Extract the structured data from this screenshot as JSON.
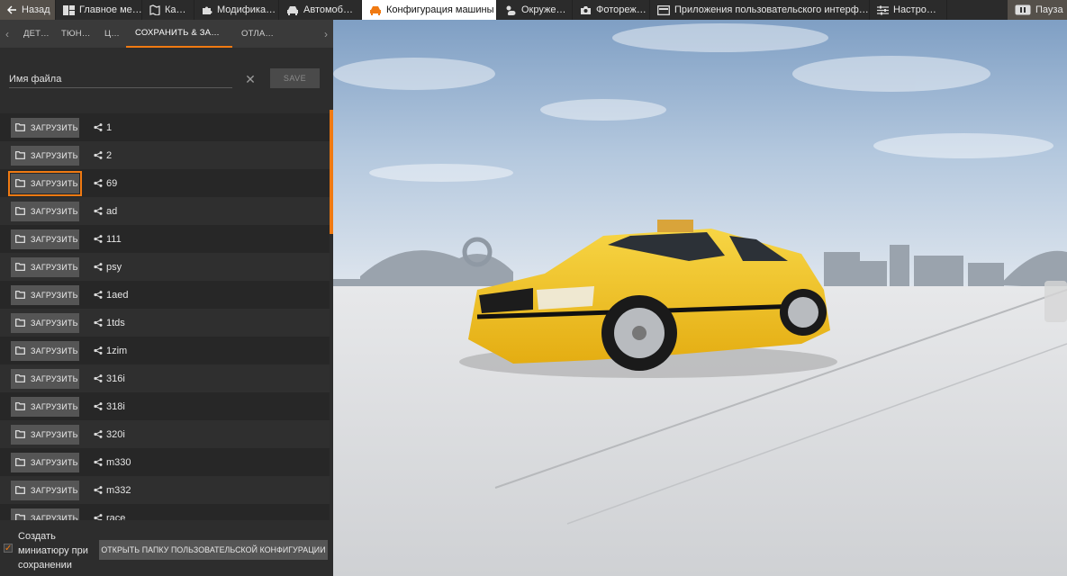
{
  "topbar": {
    "back": "Назад",
    "items": [
      {
        "label": "Главное ме…",
        "icon": "main-menu-icon"
      },
      {
        "label": "Ка…",
        "icon": "map-icon"
      },
      {
        "label": "Модифика…",
        "icon": "puzzle-icon"
      },
      {
        "label": "Автомоб…",
        "icon": "car-icon"
      },
      {
        "label": "Конфигурация машины",
        "icon": "car-config-icon"
      },
      {
        "label": "Окруже…",
        "icon": "weather-icon"
      },
      {
        "label": "Фотореж…",
        "icon": "camera-icon"
      },
      {
        "label": "Приложения пользовательского интерф…",
        "icon": "apps-icon"
      },
      {
        "label": "Настро…",
        "icon": "settings-sliders-icon"
      }
    ],
    "pause": "Пауза"
  },
  "tabs": {
    "items": [
      "ДЕТ…",
      "ТЮН…",
      "Ц…",
      "СОХРАНИТЬ & ЗА…",
      "ОТЛА…"
    ],
    "active_index": 3
  },
  "save": {
    "placeholder": "Имя файла",
    "clear_symbol": "✕",
    "button": "SAVE"
  },
  "configs": {
    "load_label": "ЗАГРУЗИТЬ",
    "focused_index": 2,
    "items": [
      "1",
      "2",
      "69",
      "ad",
      "111",
      "psy",
      "1aed",
      "1tds",
      "1zim",
      "316i",
      "318i",
      "320i",
      "m330",
      "m332",
      "race"
    ]
  },
  "footer": {
    "checkbox_checked": true,
    "checkbox_label": "Создать миниатюру при сохранении",
    "open_folder": "ОТКРЫТЬ ПАПКУ ПОЛЬЗОВАТЕЛЬСКОЙ КОНФИГУРАЦИИ"
  },
  "colors": {
    "accent": "#f07a12",
    "car_body": "#f2c21f",
    "sky": "#9fb9d6"
  }
}
